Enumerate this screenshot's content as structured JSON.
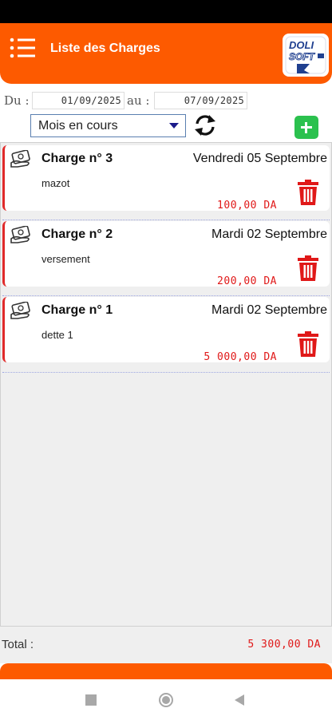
{
  "header": {
    "title": "Liste des Charges",
    "logo_text_top": "DOLI",
    "logo_text_bottom": "SOFT"
  },
  "filter": {
    "from_label": "Du :",
    "from_date": "01/09/2025",
    "to_label": "au :",
    "to_date": "07/09/2025",
    "period_selected": "Mois en cours"
  },
  "charges": [
    {
      "title": "Charge n° 3",
      "date": "Vendredi 05 Septembre",
      "description": "mazot",
      "amount": "100,00 DA"
    },
    {
      "title": "Charge n° 2",
      "date": "Mardi 02 Septembre",
      "description": "versement",
      "amount": "200,00 DA"
    },
    {
      "title": "Charge n° 1",
      "date": "Mardi 02 Septembre",
      "description": "dette 1",
      "amount": "5 000,00 DA"
    }
  ],
  "footer": {
    "total_label": "Total :",
    "total_value": "5 300,00 DA"
  },
  "colors": {
    "accent": "#fd5a00",
    "amount": "#e01818",
    "add": "#2bc14e",
    "card_border": "#e02a2a"
  },
  "icons": [
    "menu-icon",
    "refresh-icon",
    "plus-icon",
    "money-icon",
    "trash-icon",
    "nav-recents-icon",
    "nav-home-icon",
    "nav-back-icon"
  ]
}
